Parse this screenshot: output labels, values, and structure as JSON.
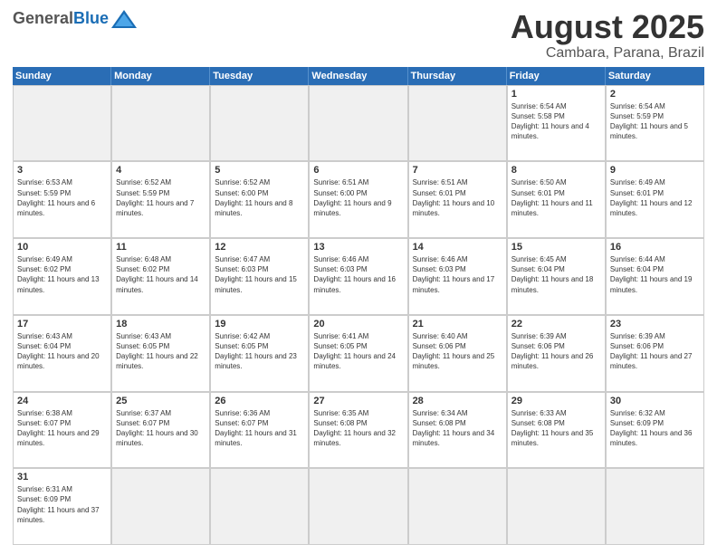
{
  "header": {
    "logo": {
      "general": "General",
      "blue": "Blue"
    },
    "title": "August 2025",
    "subtitle": "Cambara, Parana, Brazil"
  },
  "weekdays": [
    "Sunday",
    "Monday",
    "Tuesday",
    "Wednesday",
    "Thursday",
    "Friday",
    "Saturday"
  ],
  "days": [
    {
      "date": "",
      "empty": true
    },
    {
      "date": "",
      "empty": true
    },
    {
      "date": "",
      "empty": true
    },
    {
      "date": "",
      "empty": true
    },
    {
      "date": "",
      "empty": true
    },
    {
      "date": "1",
      "sunrise": "6:54 AM",
      "sunset": "5:58 PM",
      "daylight": "11 hours and 4 minutes."
    },
    {
      "date": "2",
      "sunrise": "6:54 AM",
      "sunset": "5:59 PM",
      "daylight": "11 hours and 5 minutes."
    },
    {
      "date": "3",
      "sunrise": "6:53 AM",
      "sunset": "5:59 PM",
      "daylight": "11 hours and 6 minutes."
    },
    {
      "date": "4",
      "sunrise": "6:52 AM",
      "sunset": "5:59 PM",
      "daylight": "11 hours and 7 minutes."
    },
    {
      "date": "5",
      "sunrise": "6:52 AM",
      "sunset": "6:00 PM",
      "daylight": "11 hours and 8 minutes."
    },
    {
      "date": "6",
      "sunrise": "6:51 AM",
      "sunset": "6:00 PM",
      "daylight": "11 hours and 9 minutes."
    },
    {
      "date": "7",
      "sunrise": "6:51 AM",
      "sunset": "6:01 PM",
      "daylight": "11 hours and 10 minutes."
    },
    {
      "date": "8",
      "sunrise": "6:50 AM",
      "sunset": "6:01 PM",
      "daylight": "11 hours and 11 minutes."
    },
    {
      "date": "9",
      "sunrise": "6:49 AM",
      "sunset": "6:01 PM",
      "daylight": "11 hours and 12 minutes."
    },
    {
      "date": "10",
      "sunrise": "6:49 AM",
      "sunset": "6:02 PM",
      "daylight": "11 hours and 13 minutes."
    },
    {
      "date": "11",
      "sunrise": "6:48 AM",
      "sunset": "6:02 PM",
      "daylight": "11 hours and 14 minutes."
    },
    {
      "date": "12",
      "sunrise": "6:47 AM",
      "sunset": "6:03 PM",
      "daylight": "11 hours and 15 minutes."
    },
    {
      "date": "13",
      "sunrise": "6:46 AM",
      "sunset": "6:03 PM",
      "daylight": "11 hours and 16 minutes."
    },
    {
      "date": "14",
      "sunrise": "6:46 AM",
      "sunset": "6:03 PM",
      "daylight": "11 hours and 17 minutes."
    },
    {
      "date": "15",
      "sunrise": "6:45 AM",
      "sunset": "6:04 PM",
      "daylight": "11 hours and 18 minutes."
    },
    {
      "date": "16",
      "sunrise": "6:44 AM",
      "sunset": "6:04 PM",
      "daylight": "11 hours and 19 minutes."
    },
    {
      "date": "17",
      "sunrise": "6:43 AM",
      "sunset": "6:04 PM",
      "daylight": "11 hours and 20 minutes."
    },
    {
      "date": "18",
      "sunrise": "6:43 AM",
      "sunset": "6:05 PM",
      "daylight": "11 hours and 22 minutes."
    },
    {
      "date": "19",
      "sunrise": "6:42 AM",
      "sunset": "6:05 PM",
      "daylight": "11 hours and 23 minutes."
    },
    {
      "date": "20",
      "sunrise": "6:41 AM",
      "sunset": "6:05 PM",
      "daylight": "11 hours and 24 minutes."
    },
    {
      "date": "21",
      "sunrise": "6:40 AM",
      "sunset": "6:06 PM",
      "daylight": "11 hours and 25 minutes."
    },
    {
      "date": "22",
      "sunrise": "6:39 AM",
      "sunset": "6:06 PM",
      "daylight": "11 hours and 26 minutes."
    },
    {
      "date": "23",
      "sunrise": "6:39 AM",
      "sunset": "6:06 PM",
      "daylight": "11 hours and 27 minutes."
    },
    {
      "date": "24",
      "sunrise": "6:38 AM",
      "sunset": "6:07 PM",
      "daylight": "11 hours and 29 minutes."
    },
    {
      "date": "25",
      "sunrise": "6:37 AM",
      "sunset": "6:07 PM",
      "daylight": "11 hours and 30 minutes."
    },
    {
      "date": "26",
      "sunrise": "6:36 AM",
      "sunset": "6:07 PM",
      "daylight": "11 hours and 31 minutes."
    },
    {
      "date": "27",
      "sunrise": "6:35 AM",
      "sunset": "6:08 PM",
      "daylight": "11 hours and 32 minutes."
    },
    {
      "date": "28",
      "sunrise": "6:34 AM",
      "sunset": "6:08 PM",
      "daylight": "11 hours and 34 minutes."
    },
    {
      "date": "29",
      "sunrise": "6:33 AM",
      "sunset": "6:08 PM",
      "daylight": "11 hours and 35 minutes."
    },
    {
      "date": "30",
      "sunrise": "6:32 AM",
      "sunset": "6:09 PM",
      "daylight": "11 hours and 36 minutes."
    },
    {
      "date": "31",
      "sunrise": "6:31 AM",
      "sunset": "6:09 PM",
      "daylight": "11 hours and 37 minutes."
    },
    {
      "date": "",
      "empty": true
    },
    {
      "date": "",
      "empty": true
    },
    {
      "date": "",
      "empty": true
    },
    {
      "date": "",
      "empty": true
    },
    {
      "date": "",
      "empty": true
    },
    {
      "date": "",
      "empty": true
    }
  ],
  "labels": {
    "sunrise": "Sunrise:",
    "sunset": "Sunset:",
    "daylight": "Daylight:"
  }
}
